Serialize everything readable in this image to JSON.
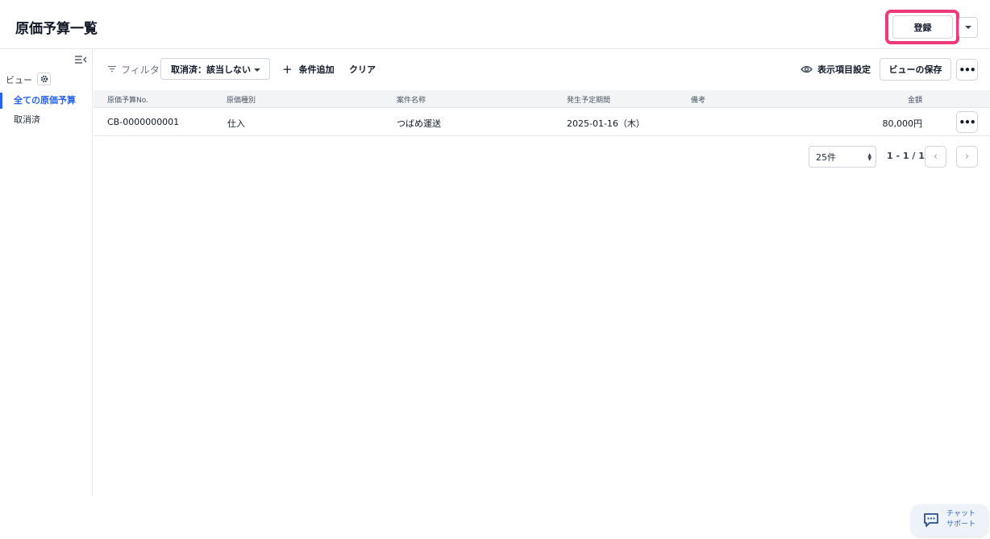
{
  "header": {
    "title": "原価予算一覧",
    "register_label": "登録",
    "highlight_color": "#ec3a7a"
  },
  "sidebar": {
    "view_label": "ビュー",
    "items": [
      {
        "label": "全ての原価予算",
        "active": true
      },
      {
        "label": "取消済",
        "active": false
      }
    ]
  },
  "toolbar": {
    "filter_label": "フィルタ",
    "filter_chip": "取消済：該当しない",
    "add_condition": "条件追加",
    "clear": "クリア",
    "column_settings": "表示項目設定",
    "save_view": "ビューの保存",
    "more": "•••"
  },
  "table": {
    "columns": [
      "原価予算No.",
      "原価種別",
      "案件名称",
      "発生予定期間",
      "備考",
      "金額"
    ],
    "rows": [
      {
        "no": "CB-0000000001",
        "type": "仕入",
        "project": "つばめ運送",
        "period": "2025-01-16（木）",
        "note": "",
        "amount": "80,000円"
      }
    ],
    "row_more": "•••"
  },
  "pagination": {
    "per_page": "25件",
    "range": "1 - 1 / 1"
  },
  "chat": {
    "line1": "チャット",
    "line2": "サポート"
  },
  "colors": {
    "accent": "#2563eb"
  }
}
